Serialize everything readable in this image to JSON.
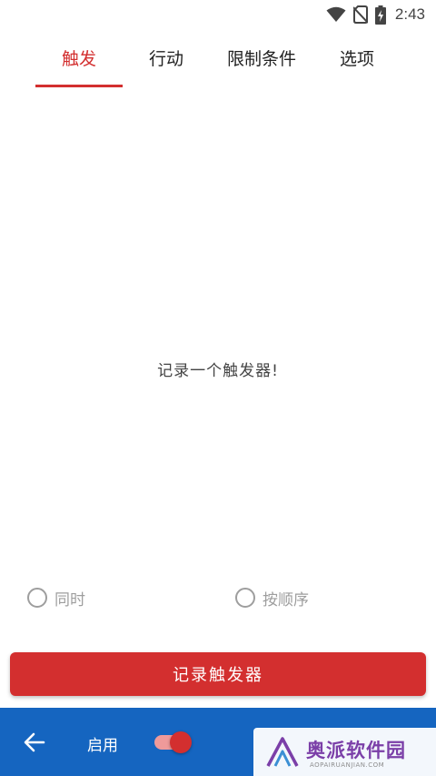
{
  "status_bar": {
    "time": "2:43",
    "icons": [
      "wifi-icon",
      "no-sim-icon",
      "battery-charging-icon"
    ]
  },
  "tabs": [
    {
      "label": "触发",
      "active": true
    },
    {
      "label": "行动",
      "active": false
    },
    {
      "label": "限制条件",
      "active": false
    },
    {
      "label": "选项",
      "active": false
    }
  ],
  "main": {
    "empty_message": "记录一个触发器!"
  },
  "radio_options": [
    {
      "label": "同时",
      "selected": false
    },
    {
      "label": "按顺序",
      "selected": false
    }
  ],
  "record_button": {
    "label": "记录触发器"
  },
  "bottom_bar": {
    "back_icon": "arrow-back-icon",
    "enable_label": "启用",
    "enable_switch_on": true
  },
  "watermark": {
    "text": "奥派软件园",
    "url": "AOPAIRUANJIAN.COM"
  },
  "colors": {
    "accent": "#d32f2f",
    "bottom_bar": "#1565c0",
    "radio_gray": "#9e9e9e"
  }
}
